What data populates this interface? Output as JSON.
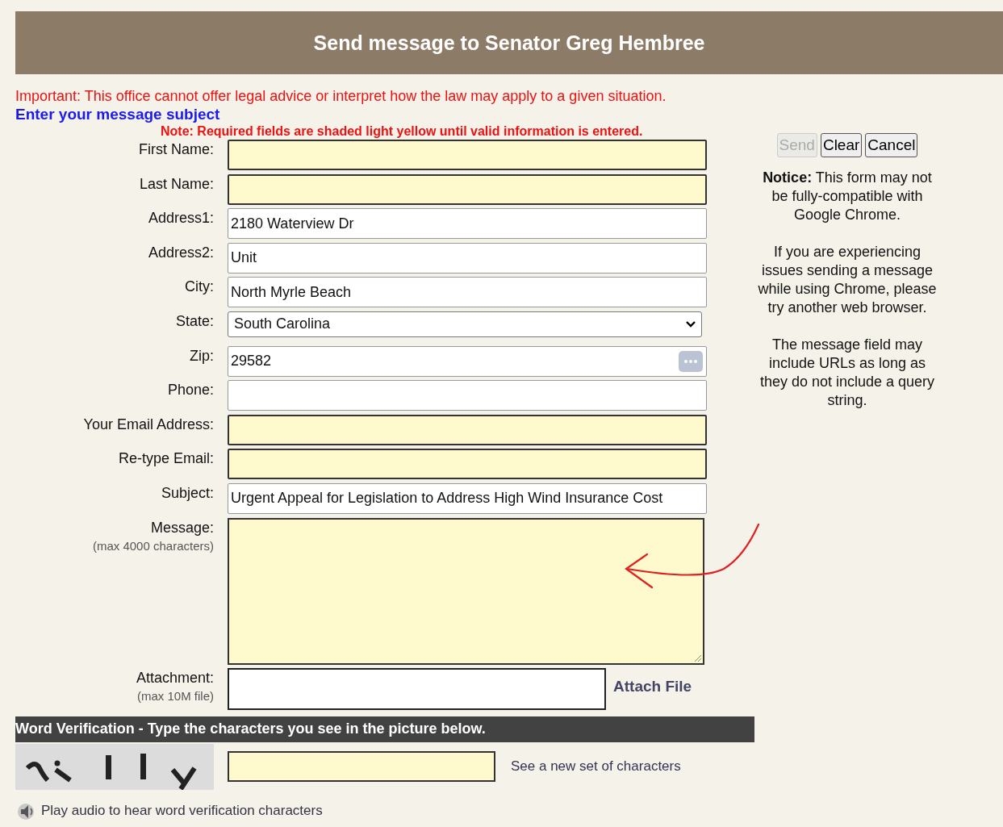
{
  "header": {
    "title": "Send message to Senator Greg Hembree"
  },
  "important": "Important: This office cannot offer legal advice or interpret how the law may apply to a given situation.",
  "subject_prompt": "Enter your message subject",
  "note": "Note: Required fields are shaded light yellow until valid information is entered.",
  "fields": [
    {
      "label": "First Name:",
      "kind": "text",
      "required": true
    },
    {
      "label": "Last Name:",
      "kind": "text",
      "required": true
    },
    {
      "label": "Address1:",
      "kind": "text",
      "value": "2180 Waterview Dr",
      "required": false
    },
    {
      "label": "Address2:",
      "kind": "text",
      "value": "Unit",
      "required": false
    },
    {
      "label": "City:",
      "kind": "text",
      "value": "North Myrle Beach",
      "required": false
    },
    {
      "label": "State:",
      "kind": "select",
      "value": "South Carolina",
      "required": false
    },
    {
      "label": "Zip:",
      "kind": "text",
      "value": "29582",
      "required": false,
      "autofill_icon": true
    },
    {
      "label": "Phone:",
      "kind": "text",
      "required": false
    },
    {
      "label": "Your Email Address:",
      "kind": "text",
      "required": true
    },
    {
      "label": "Re-type Email:",
      "kind": "text",
      "required": true
    },
    {
      "label": "Subject:",
      "kind": "text",
      "value": "Urgent Appeal for Legislation to Address High Wind Insurance Cost",
      "required": false
    },
    {
      "label": "Message:",
      "sublabel": "(max 4000 characters)",
      "kind": "textarea",
      "required": true
    },
    {
      "label": "Attachment:",
      "sublabel": "(max 10M file)",
      "kind": "file",
      "required": false,
      "link": "Attach File"
    }
  ],
  "buttons": [
    {
      "label": "Send",
      "disabled": true
    },
    {
      "label": "Clear",
      "disabled": false
    },
    {
      "label": "Cancel",
      "disabled": false
    }
  ],
  "notice": [
    "**Notice:** This form may not be fully-compatible with Google Chrome.",
    "If you are experiencing issues sending a message while using Chrome, please try another web browser.",
    "The message field may include URLs as long as they do not include a query string."
  ],
  "verification": {
    "title": "Word Verification - Type the characters you see in the picture below.",
    "answer_required": true,
    "new_set_link": "See a new set of characters",
    "audio_link": "Play audio to hear word verification characters"
  }
}
